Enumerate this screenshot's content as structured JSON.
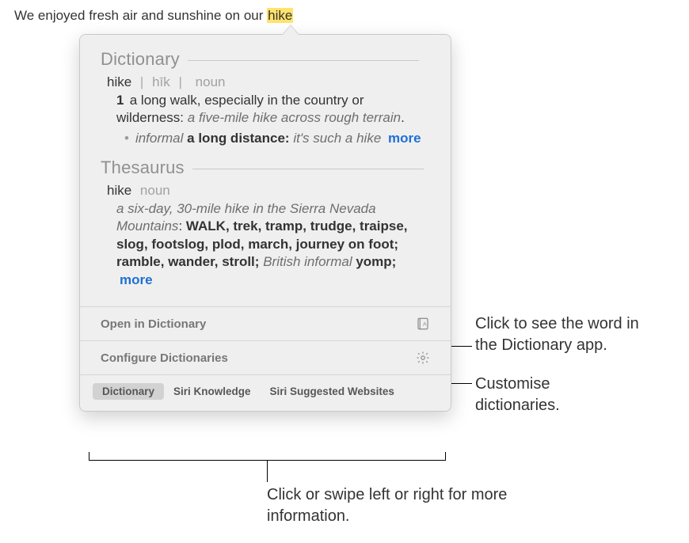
{
  "source": {
    "pre": "We enjoyed fresh air and sunshine on our ",
    "highlighted": "hike"
  },
  "popover": {
    "dictionary": {
      "heading": "Dictionary",
      "headword": "hike",
      "pronunciation": "hīk",
      "pos": "noun",
      "sense_num": "1",
      "definition": "a long walk, especially in the country or wilderness:",
      "example": "a five-mile hike across rough terrain",
      "sub_label": "informal",
      "sub_def": "a long distance:",
      "sub_example": "it's such a hike",
      "more": "more"
    },
    "thesaurus": {
      "heading": "Thesaurus",
      "headword": "hike",
      "pos": "noun",
      "example_pre": "a six-day, 30-mile hike in the Sierra Nevada Mountains",
      "syn_first": "WALK",
      "syns_rest": "trek, tramp, trudge, traipse, slog, footslog, plod, march, journey on foot; ramble, wander, stroll;",
      "brit_label": "British informal",
      "brit_word": "yomp;",
      "more": "more"
    },
    "actions": {
      "open": "Open in Dictionary",
      "configure": "Configure Dictionaries"
    },
    "tabs": {
      "dictionary": "Dictionary",
      "siri_knowledge": "Siri Knowledge",
      "siri_websites": "Siri Suggested Websites"
    }
  },
  "callouts": {
    "open": "Click to see the word in the Dictionary app.",
    "configure": "Customise dictionaries.",
    "tabs": "Click or swipe left or right for more information."
  }
}
